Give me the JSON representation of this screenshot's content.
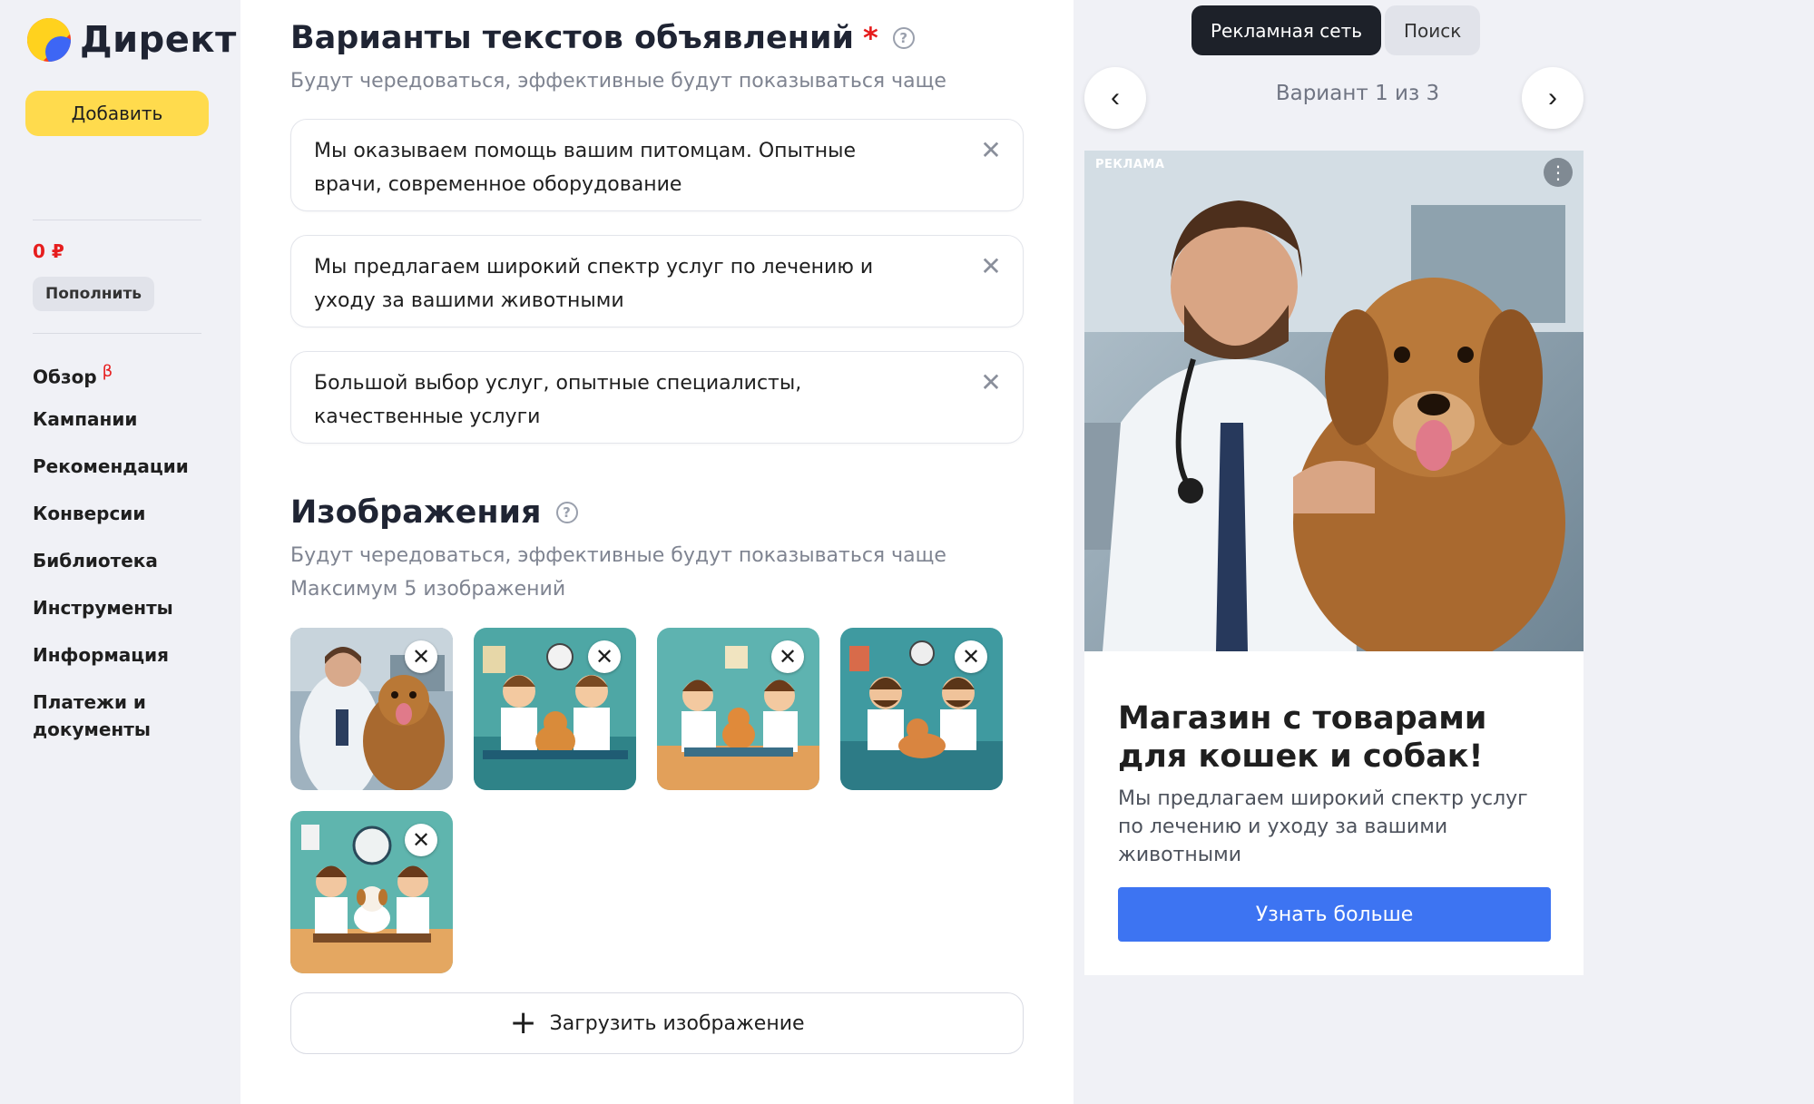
{
  "app": {
    "logo_text": "Директ"
  },
  "sidebar": {
    "add_label": "Добавить",
    "balance": "0 ₽",
    "topup_label": "Пополнить",
    "nav": [
      {
        "label": "Обзор",
        "badge": "β"
      },
      {
        "label": "Кампании"
      },
      {
        "label": "Рекомендации"
      },
      {
        "label": "Конверсии"
      },
      {
        "label": "Библиотека"
      },
      {
        "label": "Инструменты"
      },
      {
        "label": "Информация"
      },
      {
        "label": "Платежи и документы"
      }
    ]
  },
  "texts_section": {
    "title": "Варианты текстов объявлений",
    "required_mark": "*",
    "subtitle": "Будут чередоваться, эффективные будут показываться чаще",
    "items": [
      "Мы оказываем помощь вашим питомцам. Опытные врачи, современное оборудование",
      "Мы предлагаем широкий спектр услуг по лечению и уходу за вашими животными",
      "Большой выбор услуг, опытные специалисты, качественные услуги"
    ]
  },
  "images_section": {
    "title": "Изображения",
    "subtitle": "Будут чередоваться, эффективные будут показываться чаще",
    "limit_note": "Максимум 5 изображений",
    "thumbnails": [
      "vet-photo",
      "vet-cartoon-1",
      "vet-cartoon-2",
      "vet-cartoon-3",
      "vet-cartoon-4"
    ],
    "upload_label": "Загрузить изображение"
  },
  "preview": {
    "tabs": [
      "Рекламная сеть",
      "Поиск"
    ],
    "active_tab": "Рекламная сеть",
    "variant_label": "Вариант 1 из 3",
    "ad": {
      "badge": "РЕКЛАМА",
      "title": "Магазин с товарами для кошек и собак!",
      "description": "Мы предлагаем широкий спектр услуг по лечению и уходу за вашими животными",
      "cta": "Узнать больше"
    }
  },
  "colors": {
    "accent_yellow": "#ffdb4d",
    "cta_blue": "#3d74f2",
    "danger_red": "#e61d1d",
    "dark_tab": "#1d2129"
  }
}
